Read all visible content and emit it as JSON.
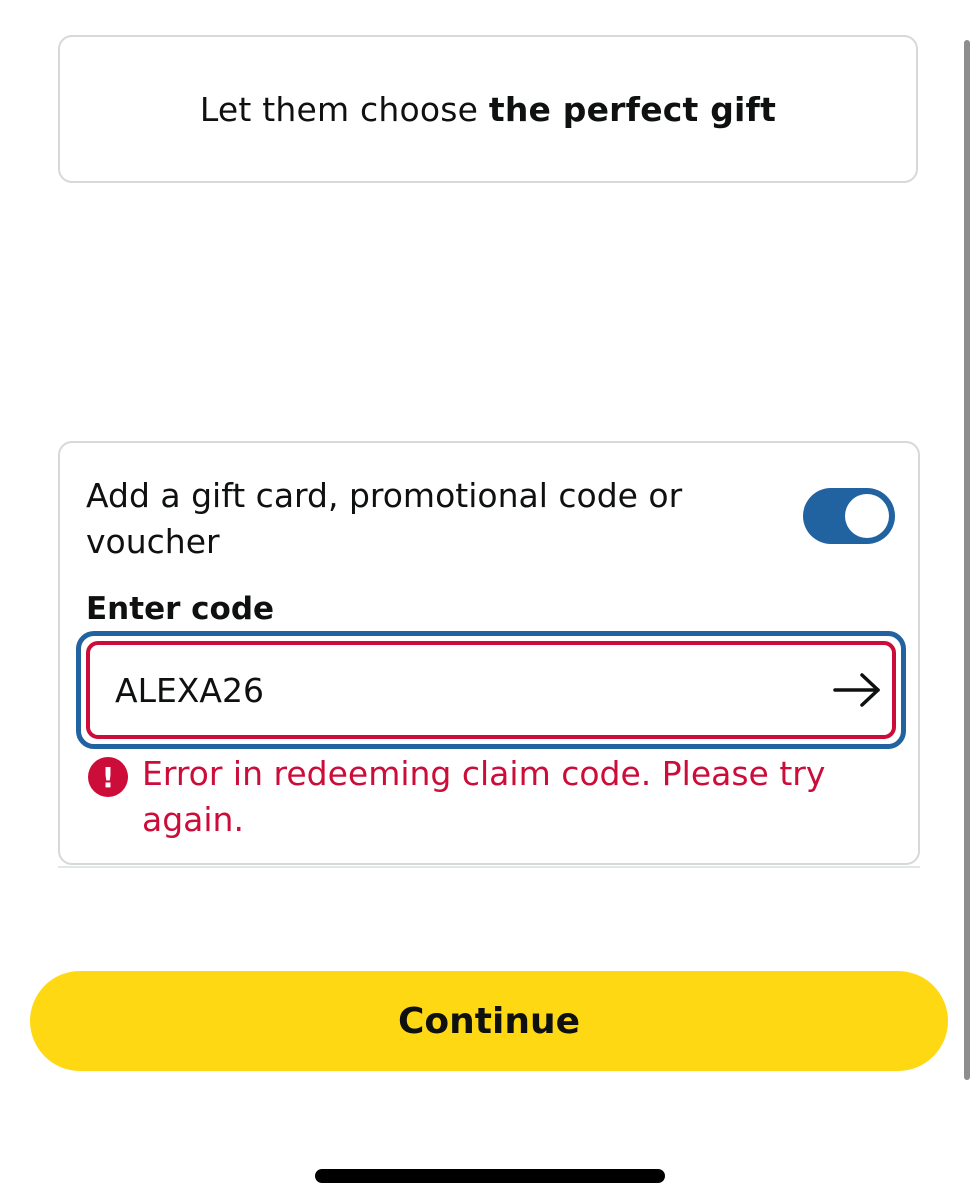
{
  "promo": {
    "text_regular": "Let them choose ",
    "text_bold": "the perfect gift"
  },
  "gift_card": {
    "title": "Add a gift card, promotional code or voucher",
    "toggle_on": true,
    "enter_label": "Enter code",
    "code_value": "ALEXA26",
    "submit_icon": "arrow-right-icon",
    "error_icon": "exclamation-icon",
    "error_glyph": "!",
    "error_message": "Error in redeeming claim code. Please try again."
  },
  "actions": {
    "continue_label": "Continue"
  },
  "colors": {
    "accent_blue": "#2162a1",
    "error_red": "#cc0c39",
    "button_yellow": "#ffd814"
  }
}
